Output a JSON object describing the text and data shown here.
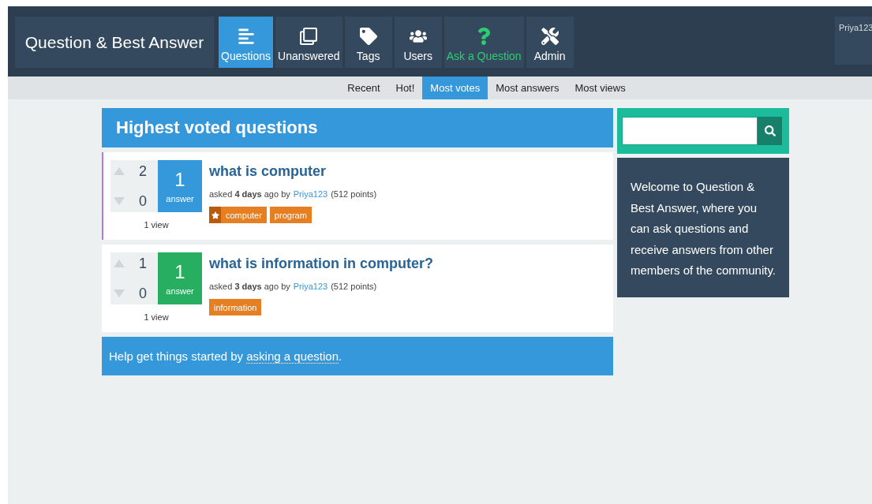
{
  "site_title": "Question & Best Answer",
  "nav": [
    {
      "label": "Questions",
      "kind": "normal",
      "selected": true
    },
    {
      "label": "Unanswered",
      "kind": "normal",
      "selected": false
    },
    {
      "label": "Tags",
      "kind": "normal",
      "selected": false
    },
    {
      "label": "Users",
      "kind": "normal",
      "selected": false
    },
    {
      "label": "Ask a Question",
      "kind": "ask",
      "selected": false
    },
    {
      "label": "Admin",
      "kind": "normal",
      "selected": false
    }
  ],
  "user": "Priya123",
  "subnav": [
    {
      "label": "Recent",
      "selected": false
    },
    {
      "label": "Hot!",
      "selected": false
    },
    {
      "label": "Most votes",
      "selected": true
    },
    {
      "label": "Most answers",
      "selected": false
    },
    {
      "label": "Most views",
      "selected": false
    }
  ],
  "heading": "Highest voted questions",
  "questions": [
    {
      "upvotes": "2",
      "downvotes": "0",
      "answers": "1",
      "answers_label": "answer",
      "accepted": false,
      "highlighted": true,
      "views": "1 view",
      "title": "what is computer",
      "meta": "asked **4 days** ago by",
      "author": "Priya123",
      "points": "(512 points)",
      "tags": [
        {
          "label": "computer",
          "favorite": true
        },
        {
          "label": "program",
          "favorite": false
        }
      ]
    },
    {
      "upvotes": "1",
      "downvotes": "0",
      "answers": "1",
      "answers_label": "answer",
      "accepted": true,
      "highlighted": false,
      "views": "1 view",
      "title": "what is information in computer?",
      "meta": "asked **3 days** ago by",
      "author": "Priya123",
      "points": "(512 points)",
      "tags": [
        {
          "label": "information",
          "favorite": false
        }
      ]
    }
  ],
  "footer": {
    "text_before": "Help get things started by",
    "link": "asking a question",
    "text_after": "."
  },
  "welcome": "Welcome to Question & Best Answer, where you can ask questions and receive answers from other members of the community."
}
